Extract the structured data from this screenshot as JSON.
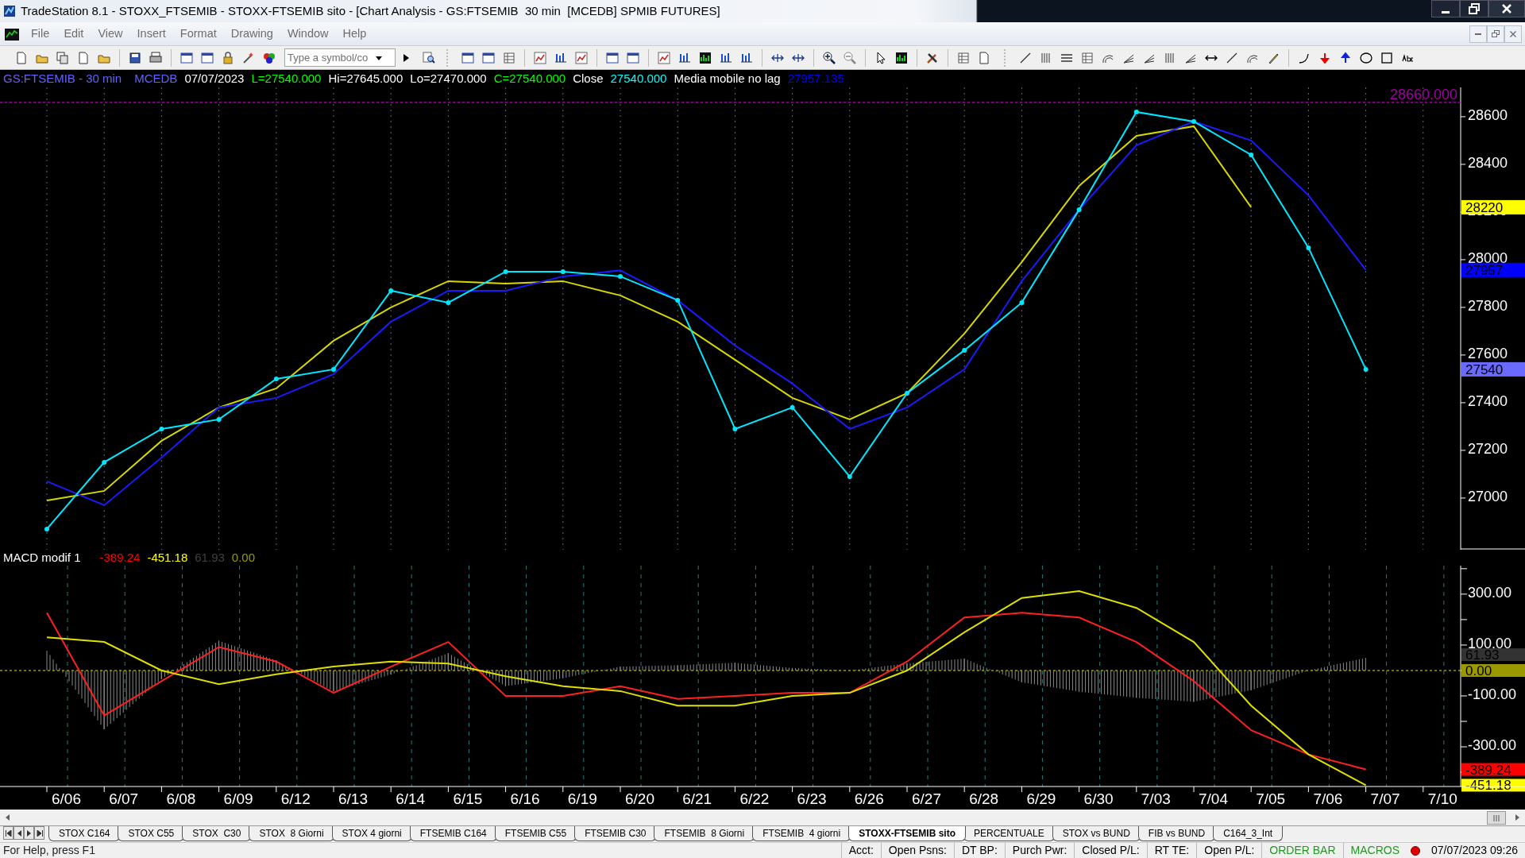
{
  "window": {
    "title": "TradeStation 8.1 - STOXX_FTSEMIB - STOXX-FTSEMIB sito - [Chart Analysis - GS:FTSEMIB  30 min  [MCEDB] SPMIB FUTURES]"
  },
  "menu": [
    "File",
    "Edit",
    "View",
    "Insert",
    "Format",
    "Drawing",
    "Window",
    "Help"
  ],
  "toolbar": {
    "symbol_field": {
      "placeholder": "Type a symbol/co"
    }
  },
  "price_pane": {
    "header": [
      {
        "text": "GS:FTSEMIB - 30 min",
        "color": "#6262ff"
      },
      {
        "text": "MCEDB",
        "color": "#6262ff"
      },
      {
        "text": "07/07/2023",
        "color": "#ffffff"
      },
      {
        "text": "L=27540.000",
        "color": "#00ff00"
      },
      {
        "text": "Hi=27645.000",
        "color": "#ffffff"
      },
      {
        "text": "Lo=27470.000",
        "color": "#ffffff"
      },
      {
        "text": "C=27540.000",
        "color": "#00ff00"
      },
      {
        "text": "Close",
        "color": "#ffffff"
      },
      {
        "text": "27540.000",
        "color": "#00ffff"
      },
      {
        "text": "Media mobile no lag",
        "color": "#ffffff"
      },
      {
        "text": "27957.135",
        "color": "#0000ff"
      }
    ],
    "chart_data": {
      "type": "line",
      "ylim": [
        26783,
        28723
      ],
      "yticks": [
        27000,
        27200,
        27400,
        27600,
        27800,
        28000,
        28200,
        28400,
        28600
      ],
      "grid": true,
      "series": [
        {
          "color": "#d8d800",
          "values": [
            26990,
            27030,
            27240,
            27380,
            27460,
            27660,
            27800,
            27910,
            27900,
            27910,
            27850,
            27740,
            27580,
            27420,
            27330,
            27440,
            27690,
            27990,
            28310,
            28520,
            28560,
            28220,
            null,
            null,
            null
          ]
        },
        {
          "color": "#1a1aff",
          "values": [
            27070,
            26970,
            27170,
            27380,
            27420,
            27520,
            27740,
            27870,
            27870,
            27930,
            27955,
            27830,
            27640,
            27480,
            27290,
            27380,
            27540,
            27910,
            28210,
            28480,
            28580,
            28500,
            28270,
            27957,
            null
          ]
        },
        {
          "color": "#00e8ff",
          "marker": true,
          "values": [
            26870,
            27150,
            27290,
            27330,
            27500,
            27540,
            27870,
            27820,
            27950,
            27950,
            27930,
            27830,
            27290,
            27380,
            27090,
            27440,
            27620,
            27820,
            28210,
            28620,
            28580,
            28440,
            28050,
            27540,
            null
          ]
        }
      ],
      "ref_lines": [
        {
          "axis": "y",
          "value": 28660,
          "label": "28660.000",
          "color": "#a000a0"
        }
      ]
    },
    "value_markers": [
      {
        "text": "28220",
        "color": "#ffff00",
        "kind": "series"
      },
      {
        "text": "27957",
        "color": "#0000ff",
        "kind": "series"
      },
      {
        "text": "27540",
        "color": "#6a6aff",
        "kind": "series"
      }
    ]
  },
  "macd_pane": {
    "header": [
      {
        "text": "MACD modif 1",
        "color": "#ffffff"
      },
      {
        "text": "-389.24",
        "color": "#ff0000"
      },
      {
        "text": "-451.18",
        "color": "#ffff00"
      },
      {
        "text": "61.93",
        "color": "#404040"
      },
      {
        "text": "0.00",
        "color": "#9a9a00"
      }
    ],
    "chart_data": {
      "type": "line",
      "categories": [
        "6/06",
        "6/07",
        "6/08",
        "6/09",
        "6/12",
        "6/13",
        "6/14",
        "6/15",
        "6/16",
        "6/19",
        "6/20",
        "6/21",
        "6/22",
        "6/23",
        "6/26",
        "6/27",
        "6/28",
        "6/29",
        "6/30",
        "7/03",
        "7/04",
        "7/05",
        "7/06",
        "7/07",
        "7/10"
      ],
      "ylim": [
        -456,
        412
      ],
      "yticks": [
        {
          "value": 300,
          "label": "300.00"
        },
        {
          "value": 100,
          "label": "100.00"
        },
        {
          "value": -100,
          "label": "-100.00"
        },
        {
          "value": -300,
          "label": "-300.00"
        }
      ],
      "grid": true,
      "series": [
        {
          "color": "#ff2020",
          "values": [
            227,
            -177,
            -42,
            92,
            35,
            -88,
            15,
            112,
            -100,
            -100,
            -62,
            -112,
            -100,
            -88,
            -88,
            35,
            208,
            227,
            208,
            112,
            -42,
            -235,
            -330,
            -389,
            null
          ]
        },
        {
          "color": "#e0e000",
          "values": [
            130,
            112,
            0,
            -54,
            -15,
            15,
            35,
            27,
            -23,
            -62,
            -81,
            -138,
            -138,
            -100,
            -88,
            0,
            150,
            285,
            312,
            246,
            112,
            -138,
            -330,
            -451,
            null
          ]
        }
      ],
      "ref_lines": [
        {
          "axis": "y",
          "value": 0,
          "color": "#9a9a00"
        }
      ]
    },
    "value_markers": [
      {
        "text": "61.93",
        "color": "#333333",
        "kind": "difference"
      },
      {
        "text": "0.00",
        "color": "#9a9a00",
        "kind": "ref_line"
      },
      {
        "text": "-389.24",
        "color": "#ff0000",
        "kind": "series"
      },
      {
        "text": "-451.18",
        "color": "#ffff00",
        "kind": "series"
      }
    ]
  },
  "tabs": [
    {
      "label": "STOX C164",
      "selected": false
    },
    {
      "label": "STOX C55",
      "selected": false
    },
    {
      "label": "STOX  C30",
      "selected": false
    },
    {
      "label": "STOX  8 Giorni",
      "selected": false
    },
    {
      "label": "STOX 4 giorni",
      "selected": false
    },
    {
      "label": "FTSEMIB C164",
      "selected": false
    },
    {
      "label": "FTSEMIB C55",
      "selected": false
    },
    {
      "label": "FTSEMIB C30",
      "selected": false
    },
    {
      "label": "FTSEMIB  8 Giorni",
      "selected": false
    },
    {
      "label": "FTSEMIB  4 giorni",
      "selected": false
    },
    {
      "label": "STOXX-FTSEMIB sito",
      "selected": true
    },
    {
      "label": "PERCENTUALE",
      "selected": false
    },
    {
      "label": "STOX vs BUND",
      "selected": false
    },
    {
      "label": "FIB vs BUND",
      "selected": false
    },
    {
      "label": "C164_3_Int",
      "selected": false
    }
  ],
  "status_bar": {
    "help": "For Help, press F1",
    "fields": [
      {
        "text": "Acct:",
        "kind": "field"
      },
      {
        "text": "Open Psns:",
        "kind": "field"
      },
      {
        "text": "DT BP:",
        "kind": "field"
      },
      {
        "text": "Purch Pwr:",
        "kind": "field"
      },
      {
        "text": "Closed P/L:",
        "kind": "field"
      },
      {
        "text": "RT TE:",
        "kind": "field"
      },
      {
        "text": "Open P/L:",
        "kind": "field"
      },
      {
        "text": "ORDER BAR",
        "kind": "toggle"
      },
      {
        "text": "MACROS",
        "kind": "toggle"
      },
      {
        "text": "07/07/2023 09:26",
        "kind": "clock"
      }
    ]
  }
}
